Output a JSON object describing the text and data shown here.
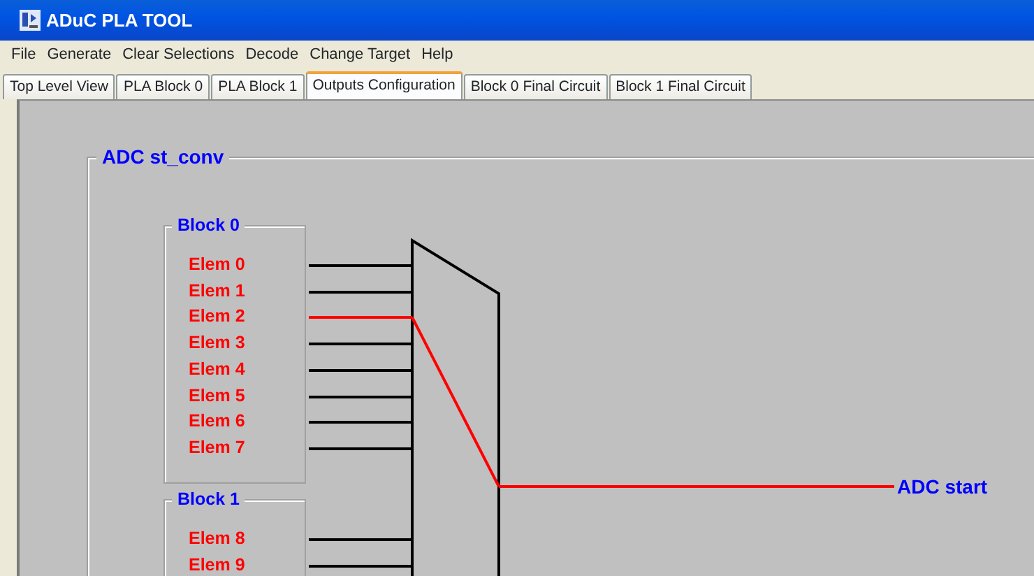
{
  "window": {
    "title": "ADuC PLA TOOL"
  },
  "menu": [
    "File",
    "Generate",
    "Clear Selections",
    "Decode",
    "Change Target",
    "Help"
  ],
  "tabs": [
    {
      "label": "Top Level View",
      "selected": false
    },
    {
      "label": "PLA Block 0",
      "selected": false
    },
    {
      "label": "PLA Block 1",
      "selected": false
    },
    {
      "label": "Outputs Configuration",
      "selected": true
    },
    {
      "label": "Block 0 Final Circuit",
      "selected": false
    },
    {
      "label": "Block 1 Final Circuit",
      "selected": false
    }
  ],
  "output_group": {
    "title": "ADC st_conv",
    "output_label": "ADC start",
    "blocks": [
      {
        "title": "Block 0",
        "elements": [
          {
            "label": "Elem 0",
            "selected": false
          },
          {
            "label": "Elem 1",
            "selected": false
          },
          {
            "label": "Elem 2",
            "selected": true
          },
          {
            "label": "Elem 3",
            "selected": false
          },
          {
            "label": "Elem 4",
            "selected": false
          },
          {
            "label": "Elem 5",
            "selected": false
          },
          {
            "label": "Elem 6",
            "selected": false
          },
          {
            "label": "Elem 7",
            "selected": false
          }
        ]
      },
      {
        "title": "Block 1",
        "elements": [
          {
            "label": "Elem 8",
            "selected": false
          },
          {
            "label": "Elem 9",
            "selected": false
          }
        ]
      }
    ]
  }
}
